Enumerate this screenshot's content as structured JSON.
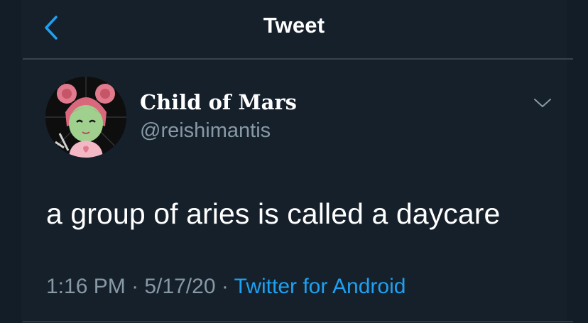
{
  "header": {
    "title": "Tweet",
    "back_icon": "chevron-left-icon"
  },
  "tweet": {
    "display_name": "Child of Mars",
    "handle": "@reishimantis",
    "text": "a group of aries is called a daycare",
    "time": "1:16 PM",
    "date": "5/17/20",
    "separator": "·",
    "source": "Twitter for Android",
    "menu_icon": "chevron-down-icon",
    "avatar_icon": "profile-avatar"
  },
  "colors": {
    "background": "#15202b",
    "text_primary": "#ffffff",
    "text_secondary": "#8899a6",
    "accent": "#1da1f2",
    "divider": "#38444d"
  }
}
